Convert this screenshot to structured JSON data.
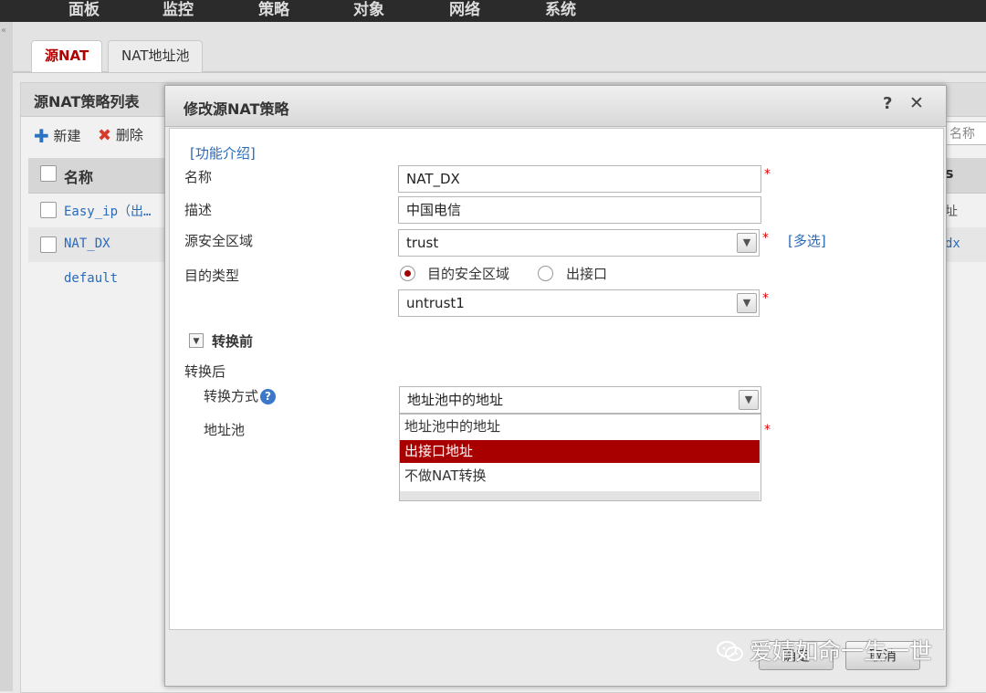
{
  "top_nav": {
    "items": [
      "面板",
      "监控",
      "策略",
      "对象",
      "网络",
      "系统"
    ]
  },
  "tabs": [
    {
      "label": "源NAT",
      "active": true
    },
    {
      "label": "NAT地址池",
      "active": false
    }
  ],
  "list_panel": {
    "title": "源NAT策略列表",
    "toolbar": {
      "new_label": "新建",
      "delete_label": "删除"
    },
    "search_placeholder": "名称",
    "header": {
      "name_col": "名称",
      "right_col_fragment": "s"
    },
    "rows": [
      {
        "name": "Easy_ip（出…",
        "right": "址"
      },
      {
        "name": "NAT_DX",
        "right": "dx"
      },
      {
        "name": "default",
        "right": ""
      }
    ]
  },
  "dialog": {
    "title": "修改源NAT策略",
    "help_icon": "question-icon",
    "close_icon": "close-icon",
    "intro_link": "[功能介绍]",
    "fields": {
      "name_label": "名称",
      "name_value": "NAT_DX",
      "desc_label": "描述",
      "desc_value": "中国电信",
      "src_zone_label": "源安全区域",
      "src_zone_value": "trust",
      "multi_select_link": "[多选]",
      "dest_type_label": "目的类型",
      "dest_type_option1": "目的安全区域",
      "dest_type_option2": "出接口",
      "dest_type_selected": "目的安全区域",
      "dest_zone_value": "untrust1",
      "before_section": "转换前",
      "after_section": "转换后",
      "convert_mode_label": "转换方式",
      "convert_mode_value": "地址池中的地址",
      "pool_label": "地址池"
    },
    "dropdown_options": [
      "地址池中的地址",
      "出接口地址",
      "不做NAT转换"
    ],
    "dropdown_highlighted": "出接口地址",
    "buttons": {
      "ok": "确定",
      "cancel": "取消"
    }
  },
  "watermark": "爱婧如命一生一世",
  "colors": {
    "accent_red": "#a80000",
    "link_blue": "#2a6ab8",
    "nav_bg": "#2b2b2b"
  }
}
